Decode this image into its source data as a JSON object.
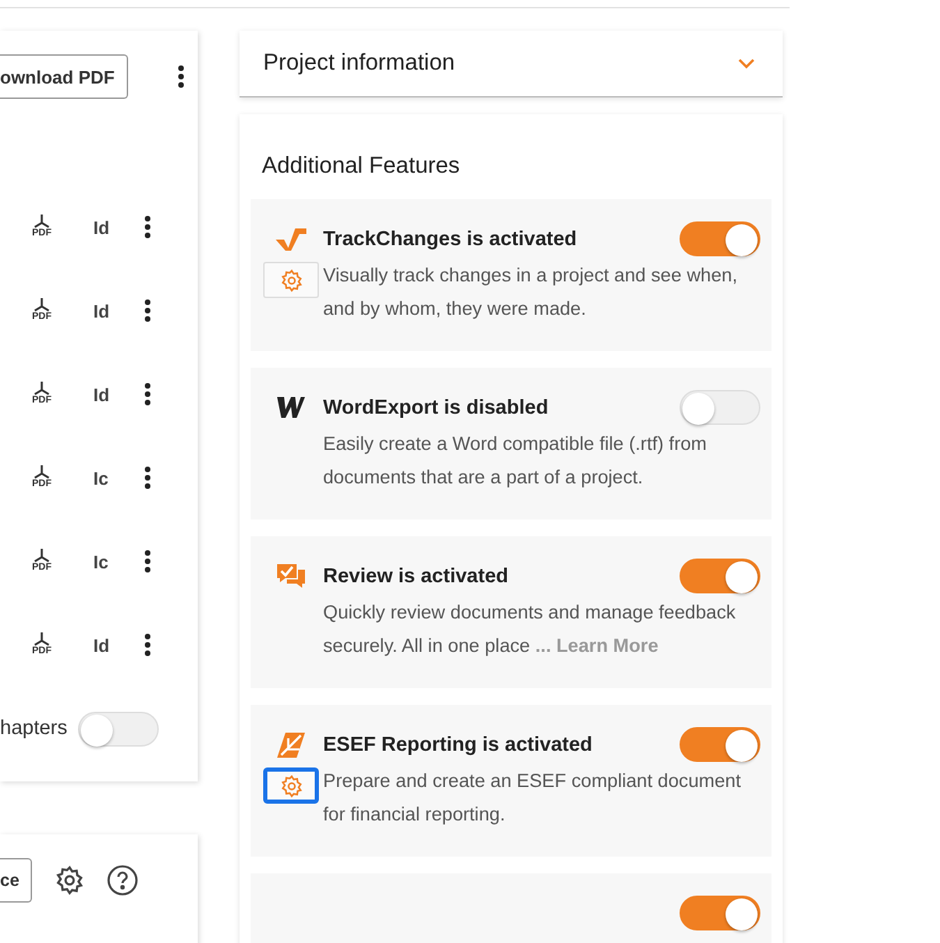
{
  "left_panel": {
    "download_button": "ownload PDF",
    "rows": [
      {
        "file_type": "PDF",
        "code": "Id"
      },
      {
        "file_type": "PDF",
        "code": "Id"
      },
      {
        "file_type": "PDF",
        "code": "Id"
      },
      {
        "file_type": "PDF",
        "code": "Ic"
      },
      {
        "file_type": "PDF",
        "code": "Ic"
      },
      {
        "file_type": "PDF",
        "code": "Id"
      }
    ],
    "chapters_label": "hapters",
    "chapters_on": false
  },
  "bottom_panel": {
    "button": "ce"
  },
  "project_information": {
    "title": "Project information",
    "expanded": false
  },
  "additional_features": {
    "title": "Additional Features",
    "features": [
      {
        "kind": "track",
        "title": "TrackChanges is activated",
        "on": true,
        "settings": true,
        "focused": false,
        "description": "Visually track changes in a project and see when, and by whom, they were made."
      },
      {
        "kind": "word",
        "title": "WordExport is disabled",
        "on": false,
        "settings": false,
        "description": "Easily create a Word compatible file (.rtf) from documents that are a part of a project."
      },
      {
        "kind": "review",
        "title": "Review is activated",
        "on": true,
        "settings": false,
        "description": "Quickly review documents and manage feedback securely. All in one place",
        "link": "... Learn More"
      },
      {
        "kind": "esef",
        "title": "ESEF Reporting is activated",
        "on": true,
        "settings": true,
        "focused": true,
        "description": "Prepare and create an ESEF compliant document for financial reporting."
      },
      {
        "kind": "partial",
        "on": true,
        "settings": false
      }
    ]
  }
}
